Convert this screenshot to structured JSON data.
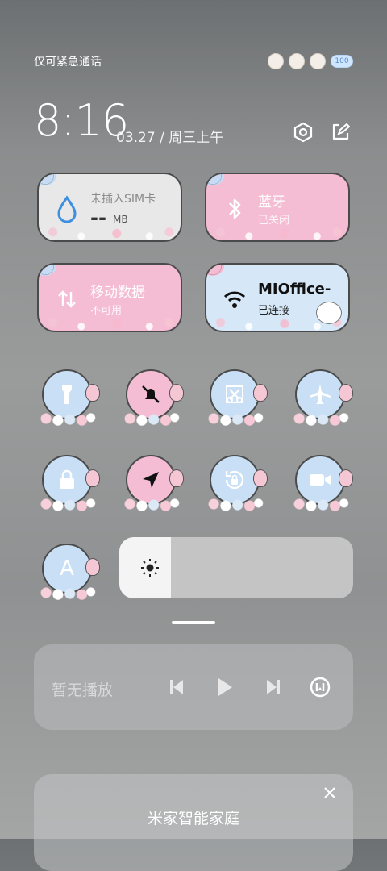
{
  "status": {
    "carrier_text": "仅可紧急通话",
    "battery": "100"
  },
  "header": {
    "time": "8:16",
    "date": "03.27 / 周三上午"
  },
  "tiles": {
    "data_usage": {
      "title": "未插入SIM卡",
      "value": "--",
      "unit": "MB"
    },
    "bluetooth": {
      "title": "蓝牙",
      "status": "已关闭"
    },
    "mobile_data": {
      "title": "移动数据",
      "status": "不可用"
    },
    "wifi": {
      "title": "MIOffice-",
      "status": "已连接"
    }
  },
  "toggles": [
    {
      "name": "flashlight",
      "icon": "flashlight-icon"
    },
    {
      "name": "mute",
      "icon": "bell-off-icon"
    },
    {
      "name": "screenshot",
      "icon": "scissors-icon"
    },
    {
      "name": "airplane",
      "icon": "airplane-icon"
    },
    {
      "name": "lock",
      "icon": "lock-icon"
    },
    {
      "name": "location",
      "icon": "location-arrow-icon"
    },
    {
      "name": "rotation-lock",
      "icon": "rotation-lock-icon"
    },
    {
      "name": "screen-record",
      "icon": "video-camera-icon"
    },
    {
      "name": "font",
      "icon": "font-A-icon",
      "label": "A"
    }
  ],
  "brightness": {
    "level_percent": 22
  },
  "media": {
    "label": "暂无播放"
  },
  "smart_home": {
    "title": "米家智能家庭"
  },
  "colors": {
    "tile_gray": "#e8e8e8",
    "tile_pink": "#f4bdd3",
    "tile_blue": "#d6e8f8",
    "water_blue": "#3e8fe0"
  }
}
